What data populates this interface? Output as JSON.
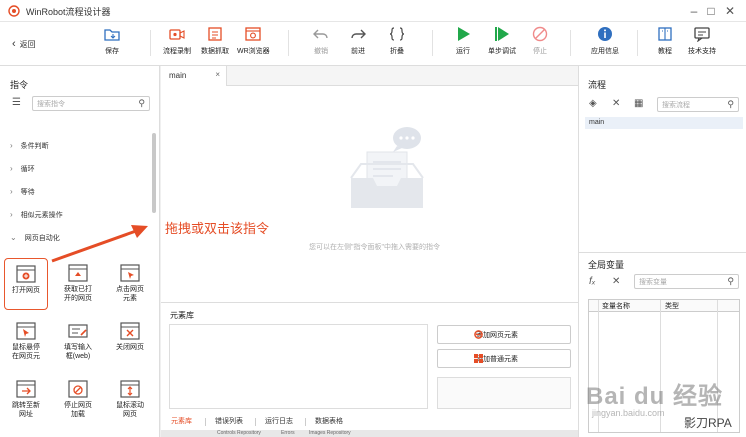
{
  "window": {
    "title": "WinRobot流程设计器"
  },
  "toolbar": {
    "back": "返回",
    "save": "保存",
    "record": "流程录制",
    "data_capture": "数据抓取",
    "wr_browser": "WR浏览器",
    "undo": "撤销",
    "redo": "前进",
    "fold": "折叠",
    "run": "运行",
    "step_debug": "单步调试",
    "stop": "停止",
    "app_info": "应用信息",
    "tutorial": "教程",
    "support": "技术支持"
  },
  "left": {
    "title": "指令",
    "search_placeholder": "搜索指令",
    "categories": [
      "条件判断",
      "循环",
      "等待",
      "相似元素操作",
      "网页自动化"
    ],
    "tiles": [
      [
        "打开网页"
      ],
      [
        "获取已打",
        "开的网页"
      ],
      [
        "点击网页",
        "元素"
      ],
      [
        "鼠标悬停",
        "在网页元"
      ],
      [
        "填写输入",
        "框(web)"
      ],
      [
        "关闭网页"
      ],
      [
        "跳转至新",
        "网址"
      ],
      [
        "停止网页",
        "加载"
      ],
      [
        "鼠标滚动",
        "网页"
      ]
    ]
  },
  "center": {
    "tab": "main",
    "empty_hint": "您可以在左侧\"指令面板\"中拖入需要的指令",
    "annotation": "拖拽或双击该指令"
  },
  "element_library": {
    "title": "元素库",
    "add_web": "添加网页元素",
    "add_normal": "添加普通元素",
    "tabs": [
      "元素库",
      "错误列表",
      "运行日志",
      "数据表格"
    ]
  },
  "right": {
    "flow_title": "流程",
    "flow_search": "搜索流程",
    "flow_item": "main",
    "vars_title": "全局变量",
    "vars_search": "搜索变量",
    "col_name": "变量名称",
    "col_type": "类型"
  },
  "statusbar": [
    "Controls Repository",
    "Errors",
    "Images Repository"
  ],
  "watermark": {
    "main": "Bai du 经验",
    "url": "jingyan.baidu.com",
    "rpa": "影刀RPA"
  },
  "colors": {
    "accent": "#e54d26",
    "primary": "#2f6fbf",
    "run": "#21a84a"
  }
}
